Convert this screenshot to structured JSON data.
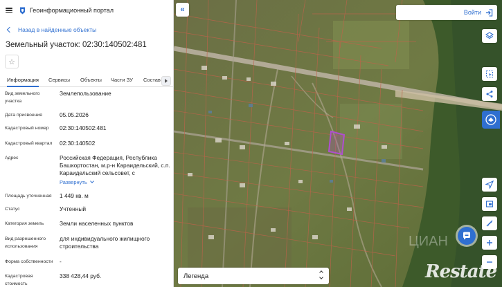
{
  "header": {
    "app_title": "Геоинформационный портал"
  },
  "nav": {
    "back_label": "Назад в найденные объекты"
  },
  "object": {
    "title": "Земельный участок: 02:30:140502:481",
    "favorite_icon": "☆"
  },
  "tabs": [
    {
      "label": "Информация",
      "active": true
    },
    {
      "label": "Сервисы",
      "active": false
    },
    {
      "label": "Объекты",
      "active": false
    },
    {
      "label": "Части ЗУ",
      "active": false
    },
    {
      "label": "Состав",
      "active": false
    }
  ],
  "info": {
    "kind_label": "Вид земельного участка",
    "kind_value": "Землепользование",
    "date_label": "Дата присвоения",
    "date_value": "05.05.2026",
    "cad_num_label": "Кадастровый номер",
    "cad_num_value": "02:30:140502:481",
    "cad_quarter_label": "Кадастровый квартал",
    "cad_quarter_value": "02:30:140502",
    "address_label": "Адрес",
    "address_value": "Российская Федерация, Республика Башкортостан, м.р-н Караидельский, с.п. Караидельский сельсовет, с",
    "expand_label": "Развернуть",
    "area_label": "Площадь уточненная",
    "area_value": "1 449 кв. м",
    "status_label": "Статус",
    "status_value": "Учтенный",
    "category_label": "Категория земель",
    "category_value": "Земли населенных пунктов",
    "usage_label": "Вид разрешенного использования",
    "usage_value": "для индивидуального жилищного строительства",
    "ownership_label": "Форма собственности",
    "ownership_value": "-",
    "cost_label": "Кадастровая стоимость",
    "cost_value": "338 428,44 руб."
  },
  "map": {
    "login_label": "Войти",
    "legend_label": "Легенда",
    "watermark": "Restate",
    "cian_watermark": "ЦИАН",
    "accent_color": "#2f6fd0",
    "parcel_color": "#b04fd0"
  }
}
